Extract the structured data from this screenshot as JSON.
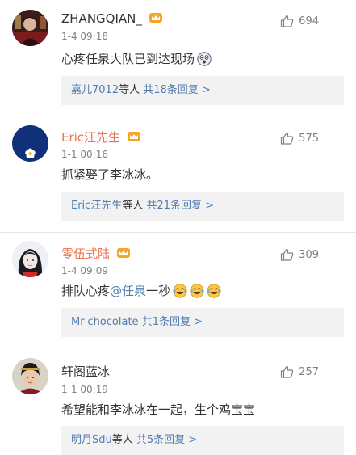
{
  "comments": [
    {
      "username": "ZHANGQIAN_",
      "timestamp": "1-4 09:18",
      "likes": "694",
      "text": "心疼任泉大队已到达现场",
      "reply_users": "嘉儿7012",
      "reply_mid": "等人",
      "reply_count": "共18条回复 >"
    },
    {
      "username": "Eric汪先生",
      "timestamp": "1-1 00:16",
      "likes": "575",
      "text": "抓紧娶了李冰冰。",
      "reply_users": "Eric汪先生",
      "reply_mid": "等人",
      "reply_count": "共21条回复 >"
    },
    {
      "username": "零伍式陆",
      "timestamp": "1-4 09:09",
      "likes": "309",
      "text_before": "排队心疼",
      "mention": "@任泉",
      "text_after": " 一秒",
      "reply_users": "Mr-chocolate",
      "reply_mid": " ",
      "reply_count": "共1条回复 >"
    },
    {
      "username": "轩阁蓝冰",
      "timestamp": "1-1 00:19",
      "likes": "257",
      "text": "希望能和李冰冰在一起，生个鸡宝宝",
      "reply_users": "明月Sdu",
      "reply_mid": "等人",
      "reply_count": "共5条回复 >"
    }
  ],
  "colors": {
    "username_vip": "#eb7350",
    "link": "#507daf",
    "meta": "#808080",
    "reply_bg": "#f2f2f2"
  },
  "icons": {
    "like": "thumbs-up-outline-icon",
    "vip": "crown-badge-icon",
    "emoji_face": "surprised-face-icon",
    "emoji_laugh": "laughing-tears-icon"
  }
}
